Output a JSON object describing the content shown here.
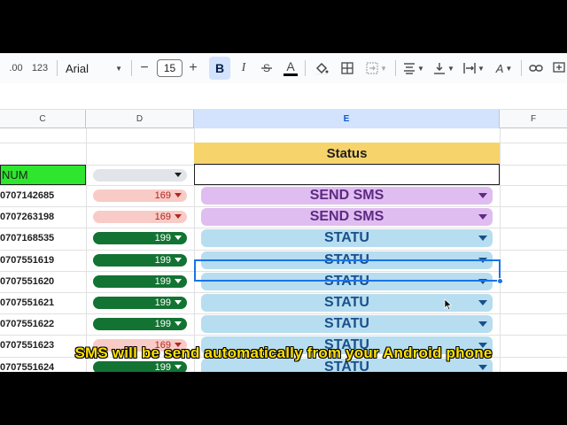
{
  "toolbar": {
    "decimal_label": ".00",
    "number_format_label": "123",
    "font_name": "Arial",
    "font_size": "15",
    "bold_label": "B",
    "italic_label": "I",
    "underline_color_label": "A",
    "text_color_label": "A"
  },
  "columns": [
    {
      "id": "col-c",
      "label": "C"
    },
    {
      "id": "col-d",
      "label": "D"
    },
    {
      "id": "col-e",
      "label": "E"
    },
    {
      "id": "col-f",
      "label": "F"
    }
  ],
  "sheet": {
    "status_header": "Status",
    "num_header": "NUM",
    "rows": [
      {
        "num": "0707142685",
        "price": "169",
        "price_style": "pink",
        "status": "SEND SMS",
        "status_style": "purple"
      },
      {
        "num": "0707263198",
        "price": "169",
        "price_style": "pink",
        "status": "SEND SMS",
        "status_style": "purple"
      },
      {
        "num": "0707168535",
        "price": "199",
        "price_style": "green",
        "status": "STATU",
        "status_style": "blue"
      },
      {
        "num": "0707551619",
        "price": "199",
        "price_style": "green",
        "status": "STATU",
        "status_style": "blue"
      },
      {
        "num": "0707551620",
        "price": "199",
        "price_style": "green",
        "status": "STATU",
        "status_style": "blue"
      },
      {
        "num": "0707551621",
        "price": "199",
        "price_style": "green",
        "status": "STATU",
        "status_style": "blue"
      },
      {
        "num": "0707551622",
        "price": "199",
        "price_style": "green",
        "status": "STATU",
        "status_style": "blue"
      },
      {
        "num": "0707551623",
        "price": "169",
        "price_style": "pink",
        "status": "STATU",
        "status_style": "blue"
      },
      {
        "num": "0707551624",
        "price": "199",
        "price_style": "green",
        "status": "STATU",
        "status_style": "blue"
      }
    ]
  },
  "caption": "SMS will be send automatically from your Android phone",
  "colors": {
    "status_header_bg": "#f7d36b",
    "num_header_bg": "#2ee62e",
    "selected_column": "#d3e3fd",
    "send_sms_chip": "#e0bdf0",
    "statu_chip": "#b7ddf0",
    "price_pink_chip": "#f8cbc7",
    "price_green_chip": "#137333",
    "caption_text": "#ffe100"
  }
}
